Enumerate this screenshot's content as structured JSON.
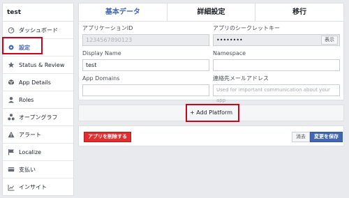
{
  "sidebar": {
    "title": "test",
    "items": [
      {
        "label": "ダッシュボード",
        "icon": "dashboard-icon"
      },
      {
        "label": "設定",
        "icon": "gear-icon"
      },
      {
        "label": "Status & Review",
        "icon": "star-icon"
      },
      {
        "label": "App Details",
        "icon": "cube-icon"
      },
      {
        "label": "Roles",
        "icon": "user-icon"
      },
      {
        "label": "オープングラフ",
        "icon": "graph-icon"
      },
      {
        "label": "アラート",
        "icon": "alert-icon"
      },
      {
        "label": "Localize",
        "icon": "flag-icon"
      },
      {
        "label": "支払い",
        "icon": "card-icon"
      },
      {
        "label": "インサイト",
        "icon": "chart-icon"
      }
    ]
  },
  "tabs": [
    {
      "label": "基本データ"
    },
    {
      "label": "詳細設定"
    },
    {
      "label": "移行"
    }
  ],
  "form": {
    "app_id": {
      "label": "アプリケーションID",
      "value": "1234567890123"
    },
    "app_secret": {
      "label": "アプリのシークレットキー",
      "value": "••••••••",
      "show_label": "表示"
    },
    "display_name": {
      "label": "Display Name",
      "value": "test"
    },
    "namespace": {
      "label": "Namespace",
      "value": ""
    },
    "app_domains": {
      "label": "App Domains",
      "value": ""
    },
    "contact_email": {
      "label": "連絡先メールアドレス",
      "placeholder": "Used for important communication about your app"
    }
  },
  "platform": {
    "label": "+ Add Platform"
  },
  "buttons": {
    "delete_app": "アプリを削除する",
    "discard": "消去",
    "save": "変更を保存"
  },
  "colors": {
    "accent": "#4267b2",
    "danger": "#e02d2d",
    "highlight": "#d0021b"
  }
}
